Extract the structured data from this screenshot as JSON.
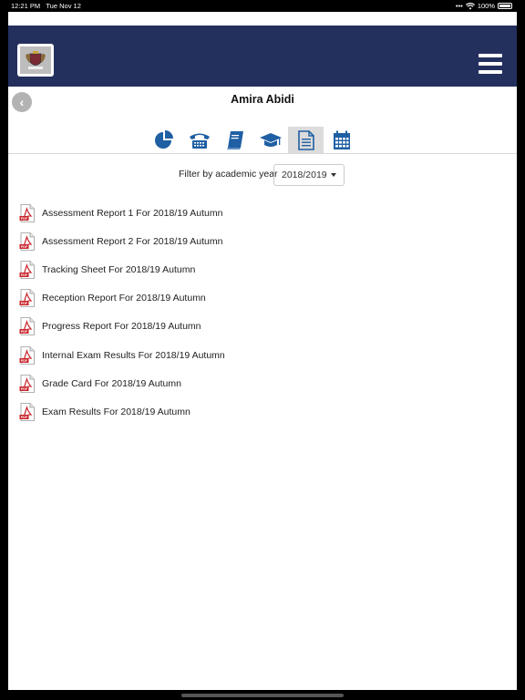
{
  "status_bar": {
    "time": "12:21 PM",
    "date": "Tue Nov 12",
    "battery": "100%"
  },
  "header": {
    "menu_icon": "hamburger-icon",
    "logo": "school-crest-logo"
  },
  "page": {
    "title": "Amira Abidi",
    "back_icon": "chevron-left-icon"
  },
  "tabs": [
    {
      "icon": "pie-chart-icon",
      "active": false
    },
    {
      "icon": "telephone-icon",
      "active": false
    },
    {
      "icon": "book-icon",
      "active": false
    },
    {
      "icon": "graduation-cap-icon",
      "active": false
    },
    {
      "icon": "document-icon",
      "active": true
    },
    {
      "icon": "calendar-icon",
      "active": false
    }
  ],
  "filter": {
    "label": "Filter by academic year",
    "selected_year": "2018/2019"
  },
  "reports": [
    {
      "label": "Assessment Report 1 For 2018/19 Autumn"
    },
    {
      "label": "Assessment Report 2 For 2018/19 Autumn"
    },
    {
      "label": "Tracking Sheet For 2018/19 Autumn"
    },
    {
      "label": "Reception Report For 2018/19 Autumn"
    },
    {
      "label": "Progress Report For 2018/19 Autumn"
    },
    {
      "label": "Internal Exam Results For 2018/19 Autumn"
    },
    {
      "label": "Grade Card For 2018/19 Autumn"
    },
    {
      "label": "Exam Results For 2018/19 Autumn"
    }
  ],
  "colors": {
    "header_bg": "#23305e",
    "icon_blue": "#1f5fa3",
    "pdf_red": "#c9252c"
  }
}
